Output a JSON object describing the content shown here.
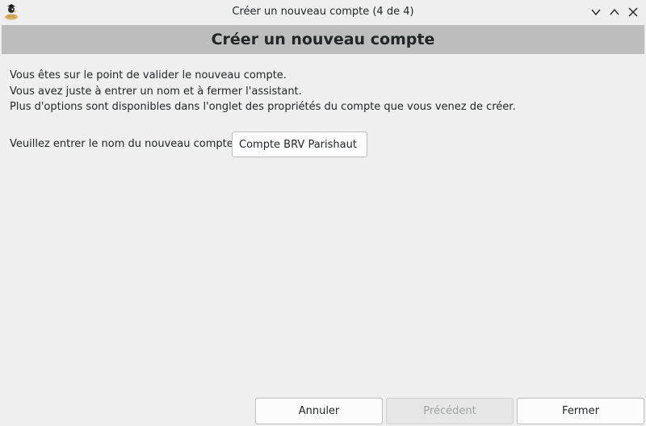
{
  "window": {
    "title": "Créer un nouveau compte (4 de 4)",
    "icons": {
      "app": "gnucash-app-icon",
      "minimize": "chevron-down-icon",
      "maximize": "chevron-up-icon",
      "close": "close-icon"
    }
  },
  "header": {
    "title": "Créer un nouveau compte"
  },
  "intro": {
    "line1": "Vous êtes sur le point de valider le nouveau compte.",
    "line2": "Vous avez juste à entrer un nom et à fermer l'assistant.",
    "line3": "Plus d'options sont disponibles dans l'onglet des propriétés du compte que vous venez de créer."
  },
  "form": {
    "name_label": "Veuillez entrer le nom du nouveau compte :",
    "name_value": "Compte BRV Parishaut"
  },
  "buttons": {
    "cancel": "Annuler",
    "previous": "Précédent",
    "close": "Fermer"
  },
  "colors": {
    "background": "#efefef",
    "header_band": "#bdbdbd",
    "text": "#232627",
    "disabled_text": "#a0a2a3"
  }
}
